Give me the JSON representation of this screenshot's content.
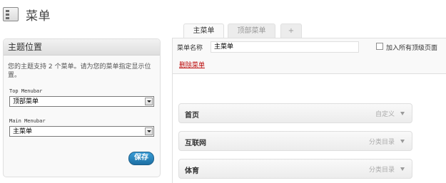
{
  "header": {
    "title": "菜单",
    "icon": "menu-screen-icon"
  },
  "theme_locations": {
    "title": "主题位置",
    "description": "您的主题支持 2 个菜单。请为您的菜单指定显示位置。",
    "locations": [
      {
        "label": "Top Menubar",
        "selected": "顶部菜单"
      },
      {
        "label": "Main Menubar",
        "selected": "主菜单"
      }
    ],
    "save_label": "保存"
  },
  "tabs": [
    {
      "label": "主菜单",
      "active": true
    },
    {
      "label": "顶部菜单",
      "active": false
    },
    {
      "label": "+",
      "active": false
    }
  ],
  "editor": {
    "name_label": "菜单名称",
    "name_value": "主菜单",
    "auto_add_label": "加入所有顶级页面",
    "auto_add_checked": false,
    "delete_label": "删除菜单"
  },
  "menu_items": [
    {
      "title": "首页",
      "type": "自定义"
    },
    {
      "title": "互联网",
      "type": "分类目录"
    },
    {
      "title": "体育",
      "type": "分类目录"
    }
  ],
  "colors": {
    "delete_link": "#bc0b0b",
    "save_button": "#1d6fa3"
  }
}
